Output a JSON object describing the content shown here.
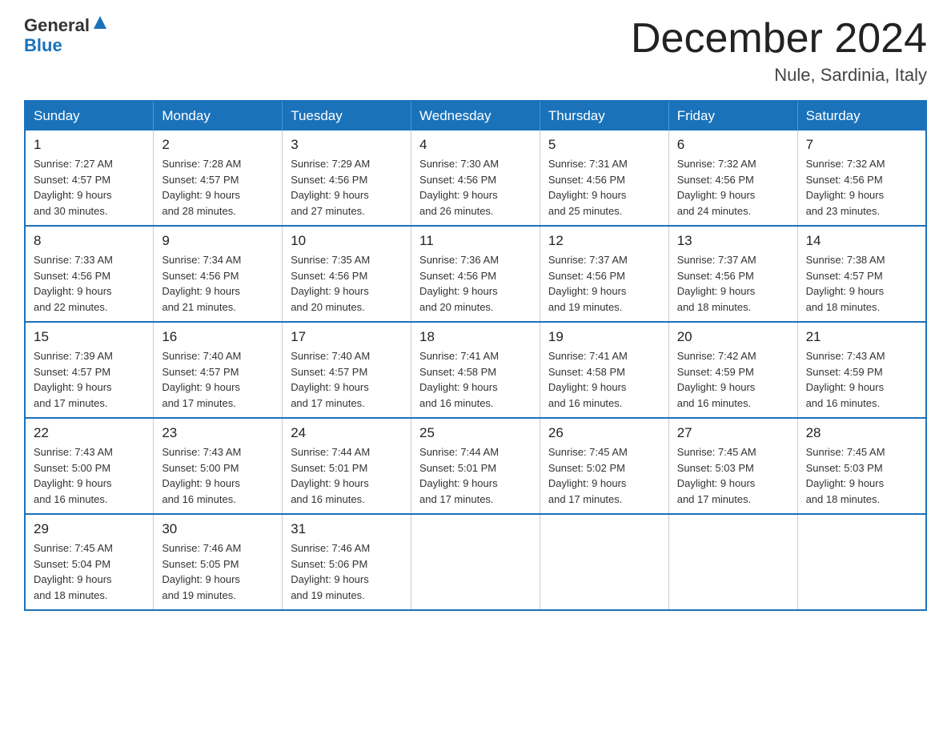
{
  "header": {
    "logo_general": "General",
    "logo_blue": "Blue",
    "month_title": "December 2024",
    "location": "Nule, Sardinia, Italy"
  },
  "days_of_week": [
    "Sunday",
    "Monday",
    "Tuesday",
    "Wednesday",
    "Thursday",
    "Friday",
    "Saturday"
  ],
  "weeks": [
    [
      {
        "day": "1",
        "sunrise": "7:27 AM",
        "sunset": "4:57 PM",
        "daylight": "9 hours and 30 minutes."
      },
      {
        "day": "2",
        "sunrise": "7:28 AM",
        "sunset": "4:57 PM",
        "daylight": "9 hours and 28 minutes."
      },
      {
        "day": "3",
        "sunrise": "7:29 AM",
        "sunset": "4:56 PM",
        "daylight": "9 hours and 27 minutes."
      },
      {
        "day": "4",
        "sunrise": "7:30 AM",
        "sunset": "4:56 PM",
        "daylight": "9 hours and 26 minutes."
      },
      {
        "day": "5",
        "sunrise": "7:31 AM",
        "sunset": "4:56 PM",
        "daylight": "9 hours and 25 minutes."
      },
      {
        "day": "6",
        "sunrise": "7:32 AM",
        "sunset": "4:56 PM",
        "daylight": "9 hours and 24 minutes."
      },
      {
        "day": "7",
        "sunrise": "7:32 AM",
        "sunset": "4:56 PM",
        "daylight": "9 hours and 23 minutes."
      }
    ],
    [
      {
        "day": "8",
        "sunrise": "7:33 AM",
        "sunset": "4:56 PM",
        "daylight": "9 hours and 22 minutes."
      },
      {
        "day": "9",
        "sunrise": "7:34 AM",
        "sunset": "4:56 PM",
        "daylight": "9 hours and 21 minutes."
      },
      {
        "day": "10",
        "sunrise": "7:35 AM",
        "sunset": "4:56 PM",
        "daylight": "9 hours and 20 minutes."
      },
      {
        "day": "11",
        "sunrise": "7:36 AM",
        "sunset": "4:56 PM",
        "daylight": "9 hours and 20 minutes."
      },
      {
        "day": "12",
        "sunrise": "7:37 AM",
        "sunset": "4:56 PM",
        "daylight": "9 hours and 19 minutes."
      },
      {
        "day": "13",
        "sunrise": "7:37 AM",
        "sunset": "4:56 PM",
        "daylight": "9 hours and 18 minutes."
      },
      {
        "day": "14",
        "sunrise": "7:38 AM",
        "sunset": "4:57 PM",
        "daylight": "9 hours and 18 minutes."
      }
    ],
    [
      {
        "day": "15",
        "sunrise": "7:39 AM",
        "sunset": "4:57 PM",
        "daylight": "9 hours and 17 minutes."
      },
      {
        "day": "16",
        "sunrise": "7:40 AM",
        "sunset": "4:57 PM",
        "daylight": "9 hours and 17 minutes."
      },
      {
        "day": "17",
        "sunrise": "7:40 AM",
        "sunset": "4:57 PM",
        "daylight": "9 hours and 17 minutes."
      },
      {
        "day": "18",
        "sunrise": "7:41 AM",
        "sunset": "4:58 PM",
        "daylight": "9 hours and 16 minutes."
      },
      {
        "day": "19",
        "sunrise": "7:41 AM",
        "sunset": "4:58 PM",
        "daylight": "9 hours and 16 minutes."
      },
      {
        "day": "20",
        "sunrise": "7:42 AM",
        "sunset": "4:59 PM",
        "daylight": "9 hours and 16 minutes."
      },
      {
        "day": "21",
        "sunrise": "7:43 AM",
        "sunset": "4:59 PM",
        "daylight": "9 hours and 16 minutes."
      }
    ],
    [
      {
        "day": "22",
        "sunrise": "7:43 AM",
        "sunset": "5:00 PM",
        "daylight": "9 hours and 16 minutes."
      },
      {
        "day": "23",
        "sunrise": "7:43 AM",
        "sunset": "5:00 PM",
        "daylight": "9 hours and 16 minutes."
      },
      {
        "day": "24",
        "sunrise": "7:44 AM",
        "sunset": "5:01 PM",
        "daylight": "9 hours and 16 minutes."
      },
      {
        "day": "25",
        "sunrise": "7:44 AM",
        "sunset": "5:01 PM",
        "daylight": "9 hours and 17 minutes."
      },
      {
        "day": "26",
        "sunrise": "7:45 AM",
        "sunset": "5:02 PM",
        "daylight": "9 hours and 17 minutes."
      },
      {
        "day": "27",
        "sunrise": "7:45 AM",
        "sunset": "5:03 PM",
        "daylight": "9 hours and 17 minutes."
      },
      {
        "day": "28",
        "sunrise": "7:45 AM",
        "sunset": "5:03 PM",
        "daylight": "9 hours and 18 minutes."
      }
    ],
    [
      {
        "day": "29",
        "sunrise": "7:45 AM",
        "sunset": "5:04 PM",
        "daylight": "9 hours and 18 minutes."
      },
      {
        "day": "30",
        "sunrise": "7:46 AM",
        "sunset": "5:05 PM",
        "daylight": "9 hours and 19 minutes."
      },
      {
        "day": "31",
        "sunrise": "7:46 AM",
        "sunset": "5:06 PM",
        "daylight": "9 hours and 19 minutes."
      },
      null,
      null,
      null,
      null
    ]
  ],
  "labels": {
    "sunrise_label": "Sunrise:",
    "sunset_label": "Sunset:",
    "daylight_label": "Daylight:"
  }
}
